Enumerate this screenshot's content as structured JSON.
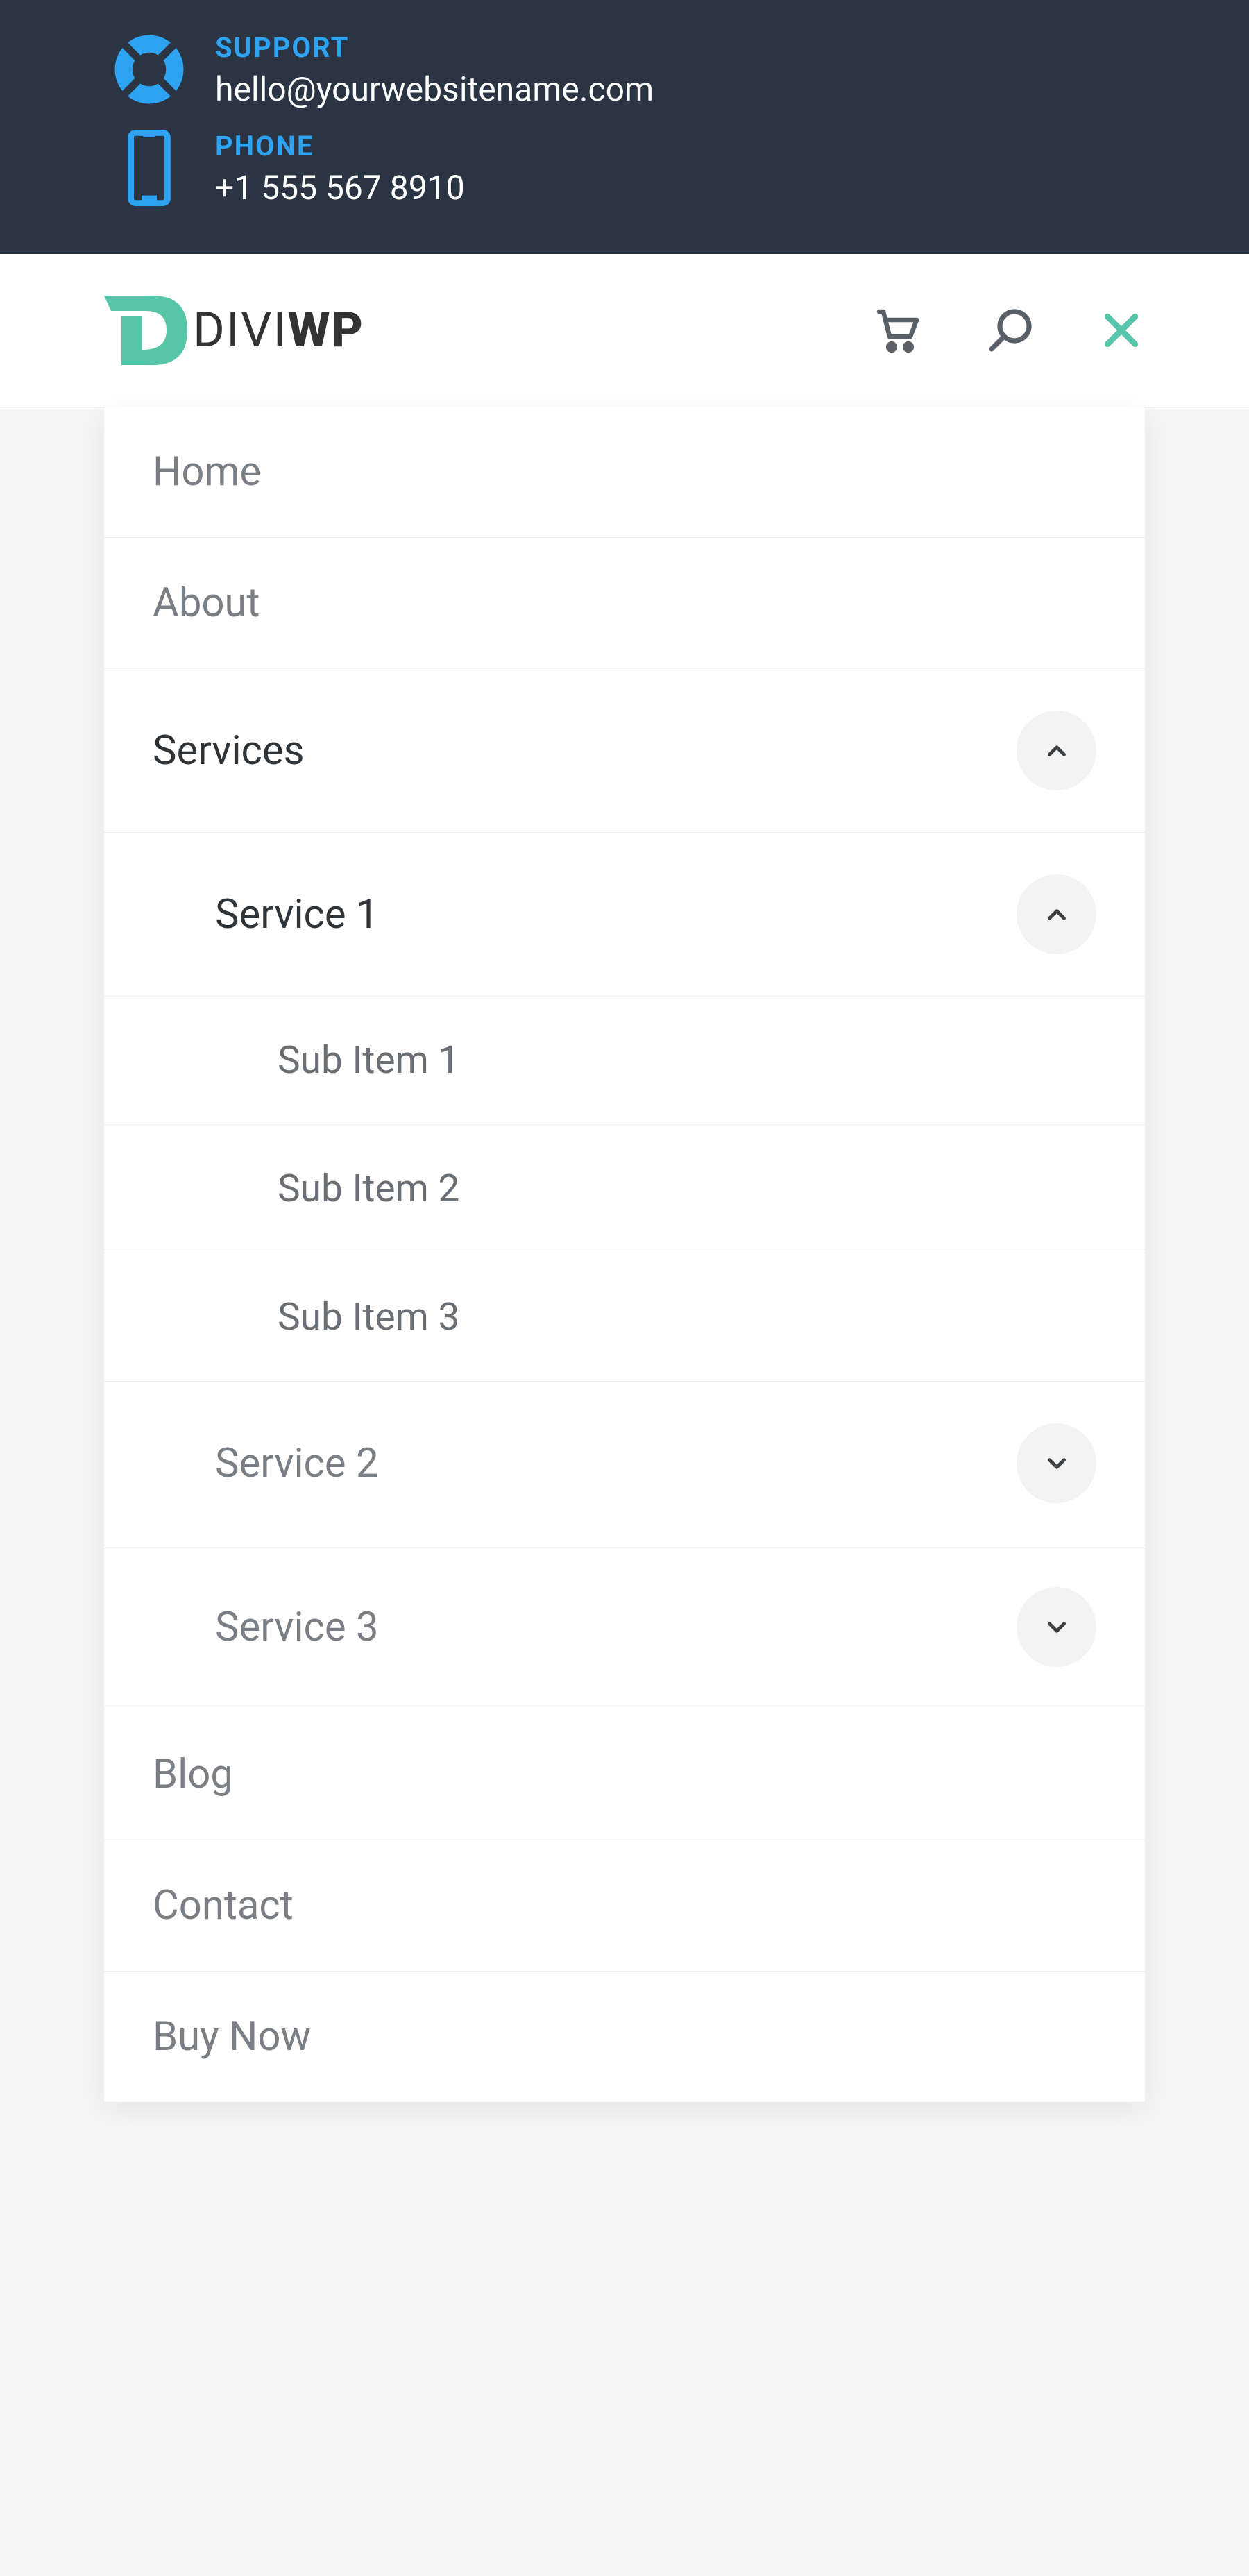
{
  "topbar": {
    "support": {
      "label": "SUPPORT",
      "value": "hello@yourwebsitename.com",
      "icon": "life-ring-icon"
    },
    "phone": {
      "label": "PHONE",
      "value": "+1 555 567 8910",
      "icon": "phone-icon"
    }
  },
  "header": {
    "logo": {
      "text1": "DIVI",
      "text2": "WP",
      "accent_color": "#56c5a8"
    },
    "actions": {
      "cart_icon": "cart-icon",
      "search_icon": "search-icon",
      "close_icon": "close-icon"
    }
  },
  "menu": {
    "items": [
      {
        "label": "Home",
        "active": false,
        "has_children": false
      },
      {
        "label": "About",
        "active": false,
        "has_children": false
      },
      {
        "label": "Services",
        "active": true,
        "has_children": true,
        "expanded": true,
        "children": [
          {
            "label": "Service 1",
            "active": true,
            "has_children": true,
            "expanded": true,
            "children": [
              {
                "label": "Sub Item 1"
              },
              {
                "label": "Sub Item 2"
              },
              {
                "label": "Sub Item 3"
              }
            ]
          },
          {
            "label": "Service 2",
            "active": false,
            "has_children": true,
            "expanded": false
          },
          {
            "label": "Service 3",
            "active": false,
            "has_children": true,
            "expanded": false
          }
        ]
      },
      {
        "label": "Blog",
        "active": false,
        "has_children": false
      },
      {
        "label": "Contact",
        "active": false,
        "has_children": false
      },
      {
        "label": "Buy Now",
        "active": false,
        "has_children": false
      }
    ]
  },
  "colors": {
    "topbar_bg": "#2a3443",
    "accent_blue": "#2ea3f2",
    "accent_teal": "#56c5a8",
    "text_muted": "#7a7f85",
    "text_dark": "#2f3438"
  }
}
